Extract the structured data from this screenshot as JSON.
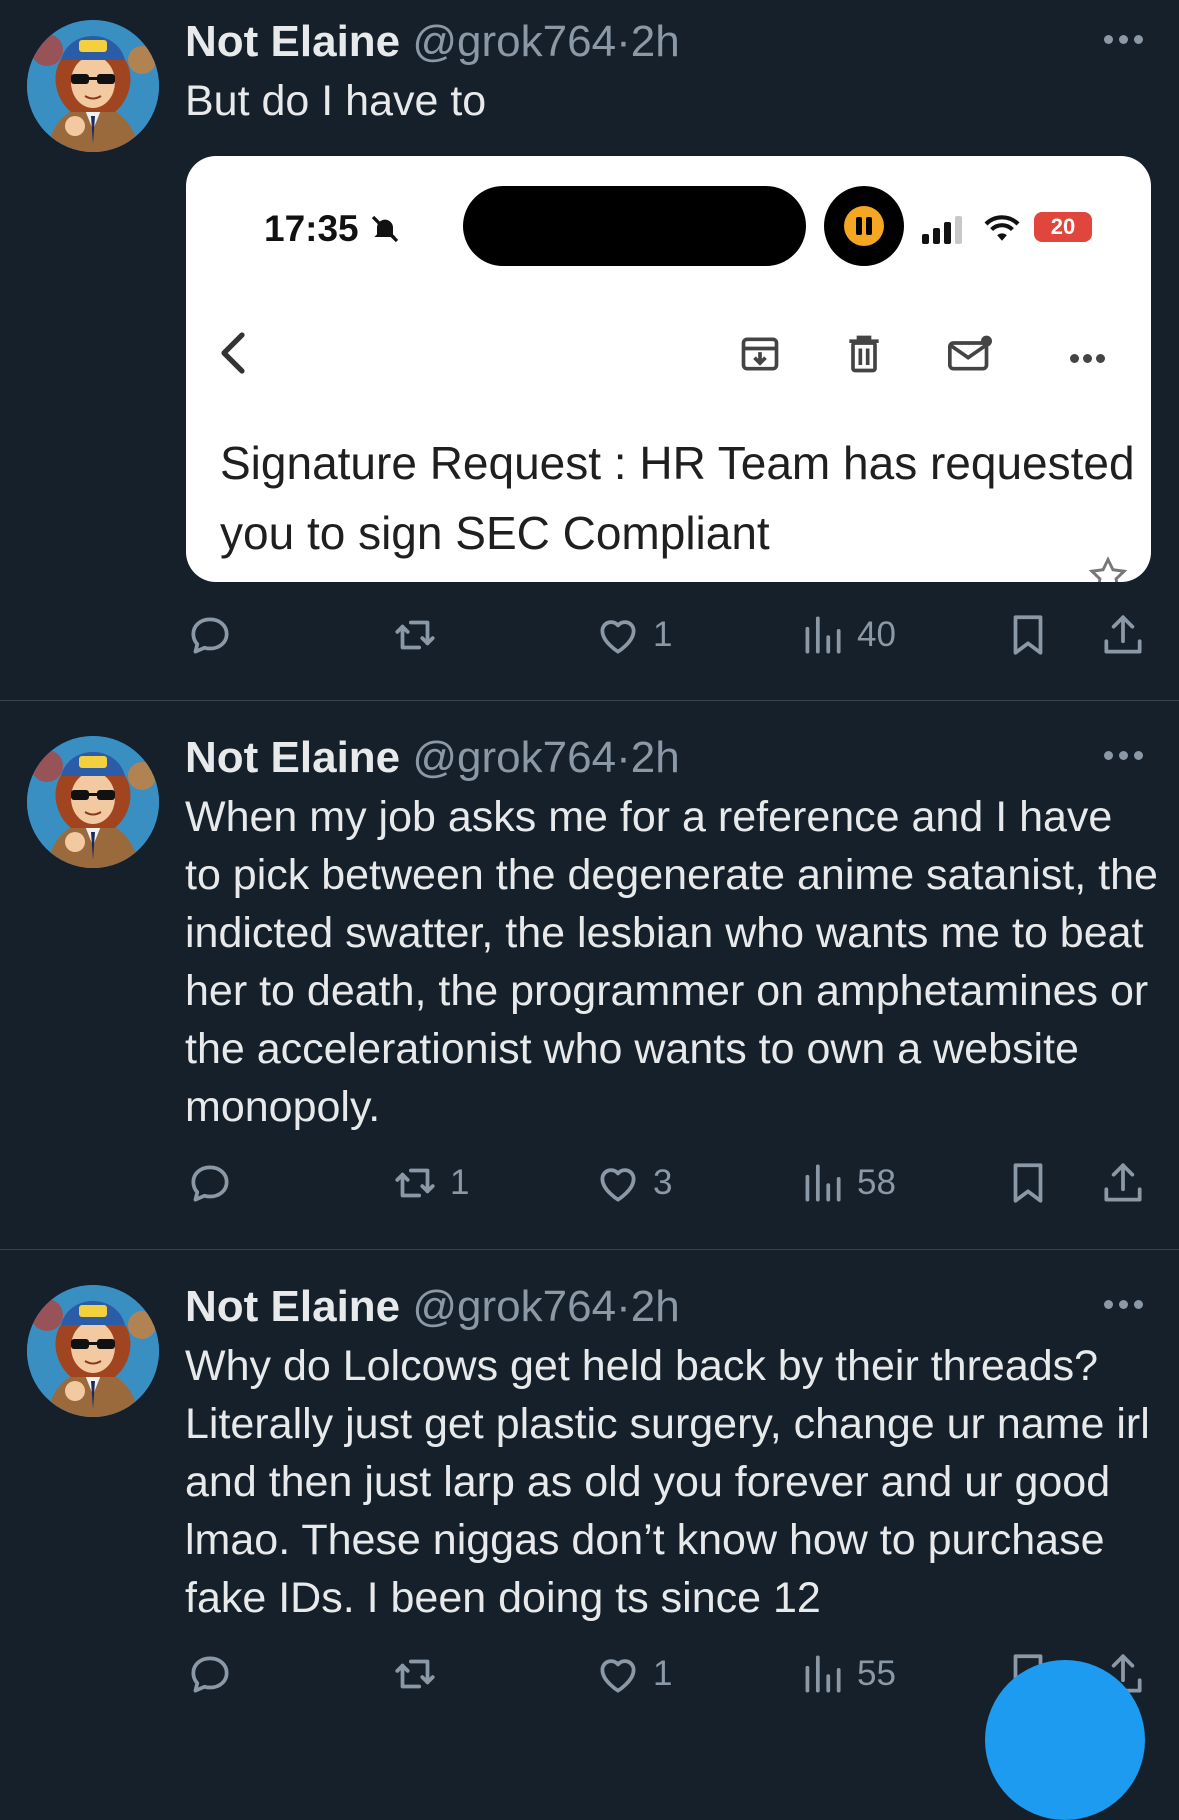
{
  "tweets": [
    {
      "name": "Not Elaine",
      "handle": "@grok764",
      "dot": "·",
      "time": "2h",
      "text": "But do I have to",
      "embed": {
        "clock": "17:35",
        "battery": "20",
        "subject": "Signature Request : HR Team has requested you to sign SEC Compliant"
      },
      "stats": {
        "replies": "",
        "reposts": "",
        "likes": "1",
        "views": "40"
      }
    },
    {
      "name": "Not Elaine",
      "handle": "@grok764",
      "dot": "·",
      "time": "2h",
      "text": "When my job asks me for a reference and I have to pick between the degenerate anime satanist, the indicted swatter, the lesbian who wants me to beat her to death, the programmer on amphetamines or the accelerationist who wants to own a website monopoly.",
      "stats": {
        "replies": "",
        "reposts": "1",
        "likes": "3",
        "views": "58"
      }
    },
    {
      "name": "Not Elaine",
      "handle": "@grok764",
      "dot": "·",
      "time": "2h",
      "text": "Why do Lolcows get held back by their threads? Literally just get plastic surgery, change ur name irl and then just larp as old you forever and ur good lmao. These niggas don’t know how to purchase fake IDs. I been doing ts since 12",
      "stats": {
        "replies": "",
        "reposts": "",
        "likes": "1",
        "views": "55"
      }
    }
  ],
  "colors": {
    "background": "#15202b",
    "muted": "#8b98a5",
    "accent": "#1d9bf0"
  },
  "icons": [
    "reply-icon",
    "repost-icon",
    "like-icon",
    "views-icon",
    "bookmark-icon",
    "share-icon",
    "more-icon",
    "back-icon",
    "archive-icon",
    "trash-icon",
    "mail-icon",
    "star-icon"
  ]
}
